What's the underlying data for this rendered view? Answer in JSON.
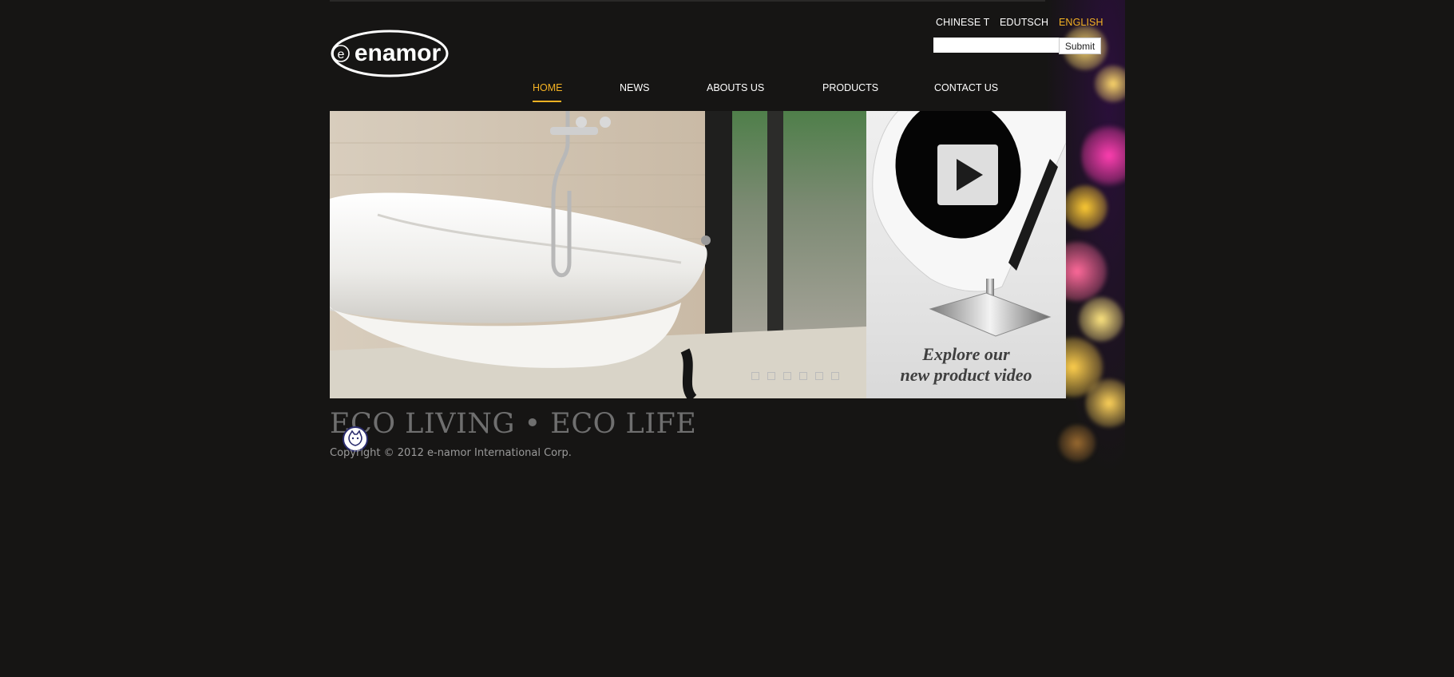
{
  "brand": {
    "logo_text": "enamor"
  },
  "languages": [
    {
      "label": "CHINESE T",
      "active": false
    },
    {
      "label": "EDUTSCH",
      "active": false
    },
    {
      "label": "ENGLISH",
      "active": true
    }
  ],
  "search": {
    "placeholder": "",
    "submit_label": "Submit"
  },
  "nav": {
    "items": [
      {
        "label": "HOME",
        "active": true
      },
      {
        "label": "NEWS",
        "active": false
      },
      {
        "label": "ABOUTS US",
        "active": false
      },
      {
        "label": "PRODUCTS",
        "active": false
      },
      {
        "label": "CONTACT US",
        "active": false
      }
    ]
  },
  "banner": {
    "slide_count": 6,
    "video_caption_line1": "Explore our",
    "video_caption_line2": "new product video"
  },
  "footer": {
    "tagline": "ECO LIVING • ECO LIFE",
    "copyright": "Copyright © 2012 e-namor International Corp."
  },
  "colors": {
    "background": "#161514",
    "accent": "#f4b223",
    "nav_text": "#ffffff",
    "tagline": "#6f6f6f",
    "copyright": "#9a9a9a"
  }
}
